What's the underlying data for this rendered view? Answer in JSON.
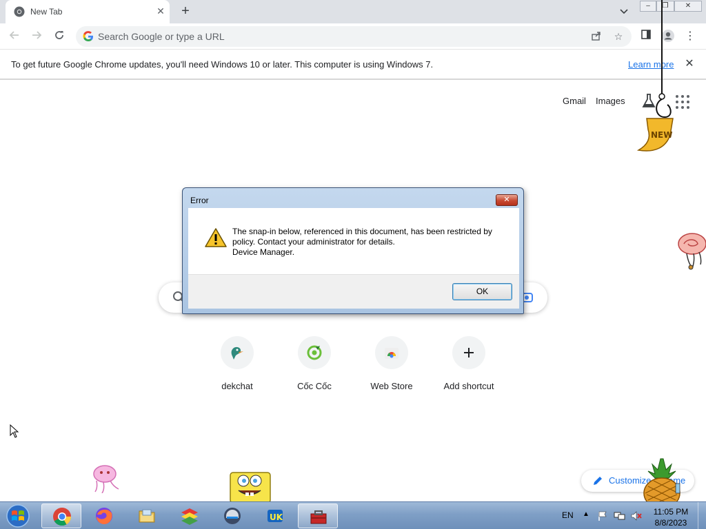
{
  "browser": {
    "tab": {
      "title": "New Tab",
      "close": "✕"
    },
    "new_tab": "+",
    "omnibox": {
      "placeholder": "Search Google or type a URL"
    },
    "infobar": {
      "message": "To get future Google Chrome updates, you'll need Windows 10 or later. This computer is using Windows 7.",
      "link": "Learn more",
      "close": "✕"
    }
  },
  "ntp": {
    "links": {
      "gmail": "Gmail",
      "images": "Images"
    },
    "shortcuts": [
      {
        "label": "dekchat",
        "icon": "dekchat-icon"
      },
      {
        "label": "Cốc Cốc",
        "icon": "coccoc-icon"
      },
      {
        "label": "Web Store",
        "icon": "webstore-icon"
      },
      {
        "label": "Add shortcut",
        "icon": "plus-icon"
      }
    ],
    "customize": "Customize Chrome"
  },
  "dialog": {
    "title": "Error",
    "close": "✕",
    "lines": [
      "The snap-in below, referenced in this document, has been restricted by",
      "policy. Contact your administrator for details.",
      "Device Manager."
    ],
    "ok": "OK"
  },
  "taskbar": {
    "language": "EN",
    "time": "11:05 PM",
    "date": "8/8/2023"
  },
  "colors": {
    "accent": "#1a73e8",
    "taskbar": "#7f9fc6"
  }
}
